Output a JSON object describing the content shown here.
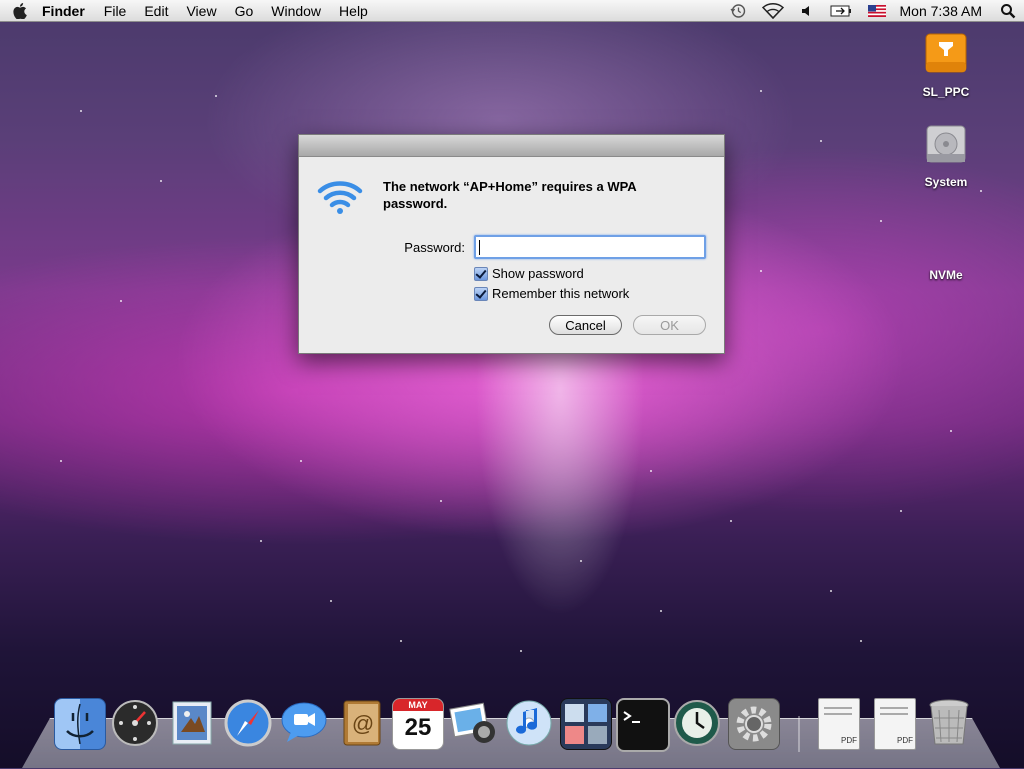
{
  "menubar": {
    "app_name": "Finder",
    "menus": [
      "File",
      "Edit",
      "View",
      "Go",
      "Window",
      "Help"
    ],
    "clock": "Mon 7:38 AM",
    "status_icons": [
      "time-machine-icon",
      "wifi-icon",
      "volume-icon",
      "battery-icon",
      "flag-us-icon",
      "spotlight-icon"
    ]
  },
  "desktop": {
    "icons": [
      {
        "label": "SL_PPC",
        "icon": "firewire-drive-icon"
      },
      {
        "label": "System",
        "icon": "hard-drive-icon"
      },
      {
        "label": "NVMe",
        "icon": "drive-icon"
      }
    ]
  },
  "dialog": {
    "message": "The network “AP+Home” requires a WPA password.",
    "password_label": "Password:",
    "password_value": "",
    "show_password_label": "Show password",
    "remember_label": "Remember this network",
    "cancel_label": "Cancel",
    "ok_label": "OK"
  },
  "dock": {
    "items": [
      "finder-icon",
      "dashboard-icon",
      "mail-icon",
      "safari-icon",
      "ichat-icon",
      "address-book-icon",
      "ical-icon",
      "iphoto-icon",
      "itunes-icon",
      "spaces-icon",
      "terminal-icon",
      "time-machine-icon",
      "system-preferences-icon",
      "pdf-document-icon",
      "pdf-document-icon",
      "trash-icon"
    ],
    "calendar": {
      "month": "MAY",
      "day": "25"
    },
    "pdf_label": "PDF"
  },
  "colors": {
    "accent": "#6fa0e6",
    "wifi_blue": "#3a8ee6"
  }
}
